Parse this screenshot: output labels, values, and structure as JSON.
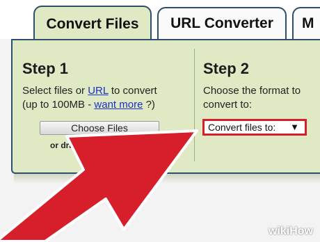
{
  "tabs": {
    "convert_files": "Convert Files",
    "url_converter": "URL Converter",
    "partial": "M"
  },
  "step1": {
    "title": "Step 1",
    "line1_prefix": "Select files or ",
    "line1_link": "URL",
    "line1_suffix": " to convert",
    "line2_prefix": "(up to 100MB - ",
    "line2_link": "want more",
    "line2_suffix": " ?)",
    "choose_button": "Choose Files",
    "drag_text": "or drag and"
  },
  "step2": {
    "title": "Step 2",
    "line1": "Choose the format to",
    "line2": "convert to:",
    "select_value": "Convert files to:",
    "select_arrow": "▼"
  },
  "overlay": {
    "arrow_color": "#d71f2b",
    "arrow_outline": "#ffffff"
  },
  "watermark": "wikiHow",
  "colors": {
    "panel_bg": "#dfeac5",
    "tab_border": "#2b4f6c",
    "link": "#1a2ec8",
    "highlight": "#d71f2b"
  }
}
